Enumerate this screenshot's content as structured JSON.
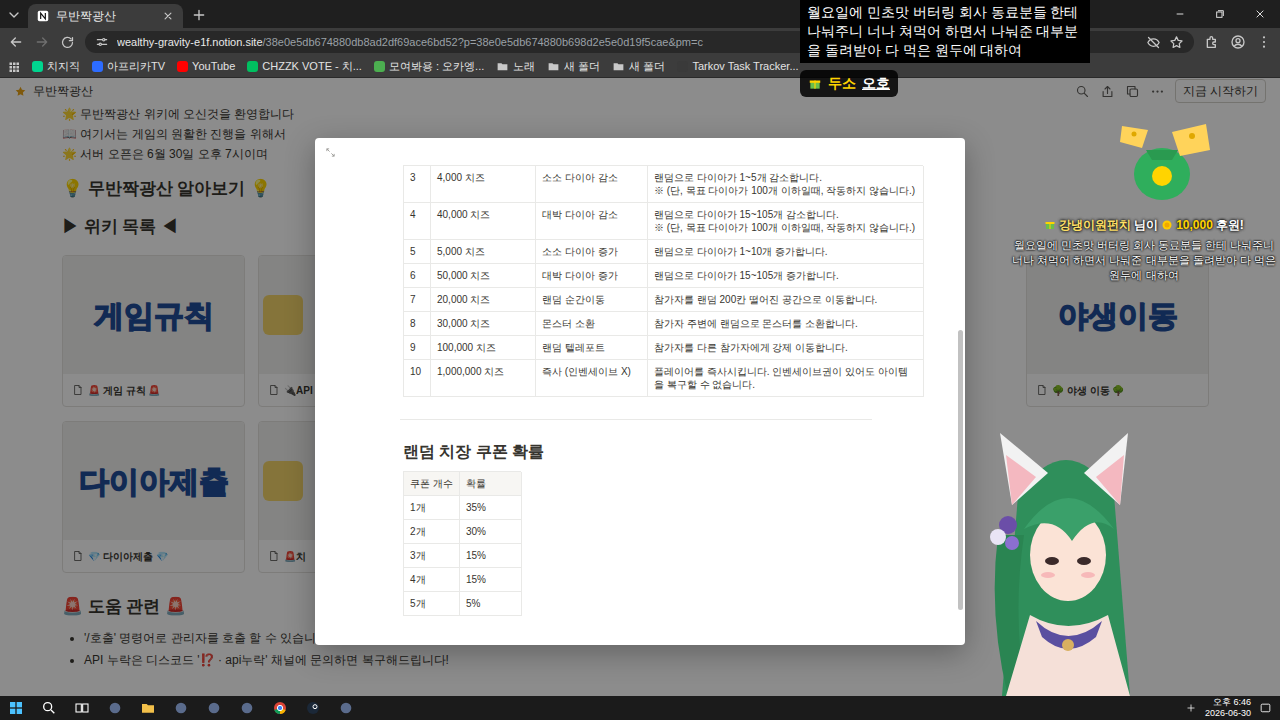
{
  "browser": {
    "tab_title": "무반짝광산",
    "url_host": "wealthy-gravity-e1f.notion.site",
    "url_path": "/38e0e5db674880db8ad2df69ace6bd52?p=38e0e5db674880b698d2e5e0d19f5cae&pm=c",
    "bookmarks": [
      {
        "label": "치지직",
        "kind": "site",
        "color": "#00d58f"
      },
      {
        "label": "아프리카TV",
        "kind": "site",
        "color": "#2d6cff"
      },
      {
        "label": "YouTube",
        "kind": "site",
        "color": "#ff0000"
      },
      {
        "label": "CHZZK VOTE - 치...",
        "kind": "site",
        "color": "#00c060"
      },
      {
        "label": "모여봐용 : 오카엥...",
        "kind": "site",
        "color": "#4caf50"
      },
      {
        "label": "노래",
        "kind": "folder",
        "color": "#c8c8c8"
      },
      {
        "label": "새 폴더",
        "kind": "folder",
        "color": "#c8c8c8"
      },
      {
        "label": "새 폴더",
        "kind": "folder",
        "color": "#c8c8c8"
      },
      {
        "label": "Tarkov Task Tracker...",
        "kind": "site",
        "color": "#3a3a3a"
      }
    ]
  },
  "notion": {
    "breadcrumb": "무반짝광산",
    "start_button": "지금 시작하기",
    "intro": [
      "🌟 무반짝광산 위키에 오신것을 환영합니다",
      "📖 여기서는 게임의 원활한 진행을 위해서",
      "🌟 서버 오픈은 6월 30일 오후 7시이며"
    ],
    "about_heading": "💡 무반짝광산 알아보기 💡",
    "wiki_heading": "▶ 위키 목록 ◀",
    "card_rows": [
      [
        {
          "image_text": "게임규칙",
          "caption": "🚨 게임 규칙 🚨",
          "partial": false
        },
        {
          "caption": "🔌API",
          "partial": true
        },
        {
          "image_text": "야생이동",
          "caption": "🌳 야생 이동 🌳",
          "partial": false
        }
      ],
      [
        {
          "image_text": "다이아제출",
          "caption": "💎 다이아제출 💎",
          "partial": false
        },
        {
          "caption": "🚨치",
          "partial": true
        }
      ]
    ],
    "help_heading": "🚨 도움 관련 🚨",
    "help_items": [
      "'/호출' 명령어로 관리자를 호출 할 수 있습니다!",
      "API 누락은 디스코드 '⁉️ · api누락' 채널에 문의하면 복구해드립니다!"
    ]
  },
  "modal": {
    "rows": [
      {
        "no": "3",
        "cost": "4,000 치즈",
        "name": "소소 다이아 감소",
        "desc": [
          "랜덤으로 다이아가 1~5개 감소합니다.",
          "※ (단, 목표 다이아가 100개 이하일때, 작동하지 않습니다.)"
        ]
      },
      {
        "no": "4",
        "cost": "40,000 치즈",
        "name": "대박 다이아 감소",
        "desc": [
          "랜덤으로 다이아가 15~105개 감소합니다.",
          "※ (단, 목표 다이아가 100개 이하일때, 작동하지 않습니다.)"
        ]
      },
      {
        "no": "5",
        "cost": "5,000 치즈",
        "name": "소소 다이아 증가",
        "desc": [
          "랜덤으로 다이아가 1~10개 증가합니다."
        ]
      },
      {
        "no": "6",
        "cost": "50,000 치즈",
        "name": "대박 다이아 증가",
        "desc": [
          "랜덤으로 다이아가 15~105개 증가합니다."
        ]
      },
      {
        "no": "7",
        "cost": "20,000 치즈",
        "name": "랜덤 순간이동",
        "desc": [
          "참가자를 랜덤 200칸 떨어진 공간으로 이동합니다."
        ]
      },
      {
        "no": "8",
        "cost": "30,000 치즈",
        "name": "몬스터 소환",
        "desc": [
          "참가자 주변에 랜덤으로 몬스터를 소환합니다."
        ]
      },
      {
        "no": "9",
        "cost": "100,000 치즈",
        "name": "랜덤 텔레포트",
        "desc": [
          "참가자를 다른 참가자에게 강제 이동합니다."
        ]
      },
      {
        "no": "10",
        "cost": "1,000,000 치즈",
        "name": "즉사 (인벤세이브 X)",
        "desc": [
          "플레이어를 즉사시킵니다. 인벤세이브권이 있어도 아이템을 복구할 수 없습니다."
        ]
      }
    ],
    "coupon_title": "랜덤 치장 쿠폰 확률",
    "coupon_columns": [
      "쿠폰 개수",
      "확률"
    ],
    "coupon_rows": [
      [
        "1개",
        "35%"
      ],
      [
        "2개",
        "30%"
      ],
      [
        "3개",
        "15%"
      ],
      [
        "4개",
        "15%"
      ],
      [
        "5개",
        "5%"
      ]
    ]
  },
  "stream": {
    "caption": "월요일에 민초맛 버터링 회사 동료분들 한테 나눠주니 너나 쳐먹어 하면서 나눠준 대부분을 돌려받아 다 먹은 원두에 대하여",
    "badge": {
      "name": "두소",
      "text": "오호"
    },
    "donation": {
      "user": "강냉이원펀치",
      "suffix": "님이",
      "amount": "10,000",
      "label": "후원!",
      "message": "월요일에 민초맛 버터링 회사 동료분들 한테 나눠주니 너나 쳐먹어 하면서 나눠준 대부분을 돌려받아 다 먹은 원두에 대하여"
    }
  },
  "taskbar": {
    "time": "오후 6:46",
    "date": "2026-06-30"
  }
}
